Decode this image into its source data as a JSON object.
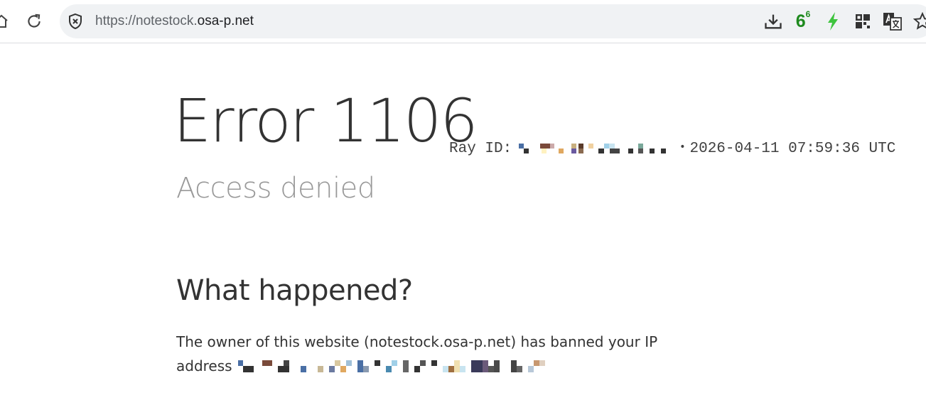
{
  "browser": {
    "url_scheme": "https://",
    "url_host_prefix": "notestock.",
    "url_host": "osa-p.net",
    "extension_badge_main": "6",
    "extension_badge_sup": "6",
    "icons": [
      "home-icon",
      "reload-icon",
      "tracking-shield-icon",
      "download-icon",
      "badge-extension-icon",
      "bolt-icon",
      "qr-grid-icon",
      "translate-icon",
      "bookmark-star-icon"
    ],
    "colors": {
      "badge_green": "#1e8a1e",
      "bolt_green": "#3ec43e"
    }
  },
  "error": {
    "title": "Error 1106",
    "ray_label": "Ray ID:",
    "ray_separator": "•",
    "timestamp": "2026-04-11 07:59:36 UTC",
    "subtitle": "Access denied"
  },
  "what_happened": {
    "heading": "What happened?",
    "text": "The owner of this website (notestock.osa-p.net) has banned your IP address"
  }
}
